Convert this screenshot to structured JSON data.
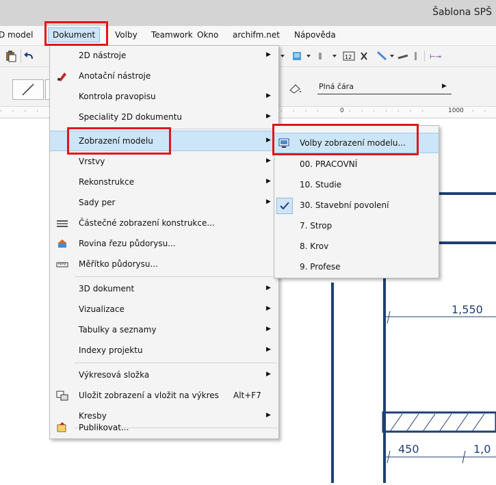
{
  "window": {
    "title": "Šablona SPŠ"
  },
  "menubar": {
    "items": [
      "D model",
      "Dokument",
      "Volby",
      "Teamwork",
      "Okno",
      "archifm.net",
      "Nápověda"
    ]
  },
  "toolbar2": {
    "line_type": "Plná čára"
  },
  "ruler": {
    "mark_0": "0",
    "mark_1000": "1000"
  },
  "dokument_menu": {
    "items": [
      {
        "label": "2D nástroje",
        "submenu": true
      },
      {
        "label": "Anotační nástroje",
        "submenu": false,
        "icon": "pen-annotation-icon"
      },
      {
        "label": "Kontrola pravopisu",
        "submenu": true
      },
      {
        "label": "Speciality 2D dokumentu",
        "submenu": true
      },
      {
        "label": "Zobrazení modelu",
        "submenu": true,
        "highlighted": true
      },
      {
        "label": "Vrstvy",
        "submenu": true
      },
      {
        "label": "Rekonstrukce",
        "submenu": true
      },
      {
        "label": "Sady per",
        "submenu": true
      },
      {
        "label": "Částečné zobrazení konstrukce...",
        "icon": "partial-structure-icon"
      },
      {
        "label": "Rovina řezu půdorysu...",
        "icon": "cut-plane-icon"
      },
      {
        "label": "Měřítko půdorysu...",
        "icon": "scale-ruler-icon"
      },
      {
        "label": "3D dokument",
        "submenu": true
      },
      {
        "label": "Vizualizace",
        "submenu": true
      },
      {
        "label": "Tabulky a seznamy",
        "submenu": true
      },
      {
        "label": "Indexy projektu",
        "submenu": true
      },
      {
        "label": "Výkresová složka",
        "submenu": true
      },
      {
        "label": "Uložit zobrazení a vložit na výkres",
        "shortcut": "Alt+F7",
        "icon": "save-view-icon"
      },
      {
        "label": "Kresby",
        "submenu": true
      },
      {
        "label": "Publikovat...",
        "icon": "publish-icon"
      }
    ]
  },
  "zobrazeni_submenu": {
    "items": [
      {
        "label": "Volby zobrazení modelu...",
        "highlighted": true,
        "icon": "model-display-options-icon"
      },
      {
        "label": "00. PRACOVNÍ"
      },
      {
        "label": "10. Studie"
      },
      {
        "label": "30. Stavební povolení",
        "checked": true
      },
      {
        "label": "7. Strop"
      },
      {
        "label": "8. Krov"
      },
      {
        "label": "9. Profese"
      }
    ]
  },
  "drawing": {
    "dim_1": "1,550",
    "dim_2": "450",
    "dim_3": "1,0"
  },
  "colors": {
    "highlight": "#cce6f7",
    "annotation_red": "#e3131b",
    "wall_blue": "#1f3f73"
  }
}
